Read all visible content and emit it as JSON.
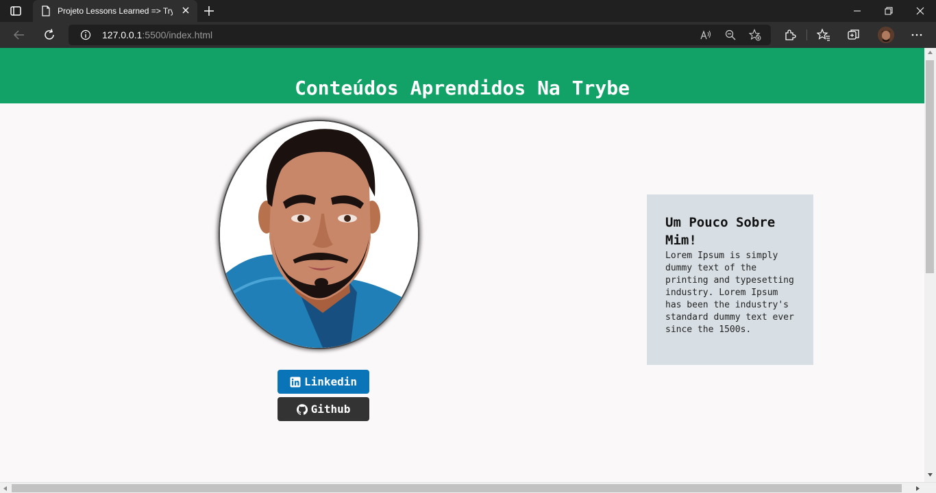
{
  "browser": {
    "tab_title": "Projeto Lessons Learned => Trybe",
    "url_host": "127.0.0.1",
    "url_path": ":5500/index.html"
  },
  "page": {
    "title": "Conteúdos Aprendidos Na Trybe",
    "linkedin_label": "Linkedin",
    "github_label": "Github",
    "about_title": "Um Pouco Sobre Mim!",
    "about_text": "Lorem Ipsum is simply dummy text of the printing and typesetting industry. Lorem Ipsum has been the industry's standard dummy text ever since the 1500s."
  },
  "colors": {
    "header_green": "#12a268",
    "linkedin_blue": "#0a74b8",
    "github_dark": "#333333",
    "card_gray": "#d7dee4"
  },
  "icons": {
    "tab": "page-icon",
    "linkedin": "linkedin-icon",
    "github": "github-icon"
  }
}
